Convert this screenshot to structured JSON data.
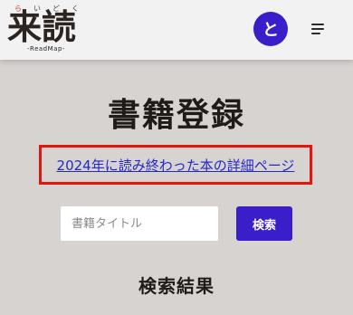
{
  "header": {
    "logo": {
      "ruby": [
        "ら",
        "い",
        "ど",
        "く"
      ],
      "main": "来読",
      "sub": "-ReadMap-"
    },
    "avatar_initial": "と",
    "menu_icon": "hamburger-menu-icon"
  },
  "main": {
    "title": "書籍登録",
    "link_text": "2024年に読み終わった本の詳細ページ",
    "search": {
      "placeholder": "書籍タイトル",
      "button_label": "検索"
    },
    "results_heading": "検索結果"
  },
  "colors": {
    "accent": "#3a1ec9",
    "highlight_border": "#e4150f",
    "link": "#2727c9",
    "background": "#d6d3d1"
  }
}
